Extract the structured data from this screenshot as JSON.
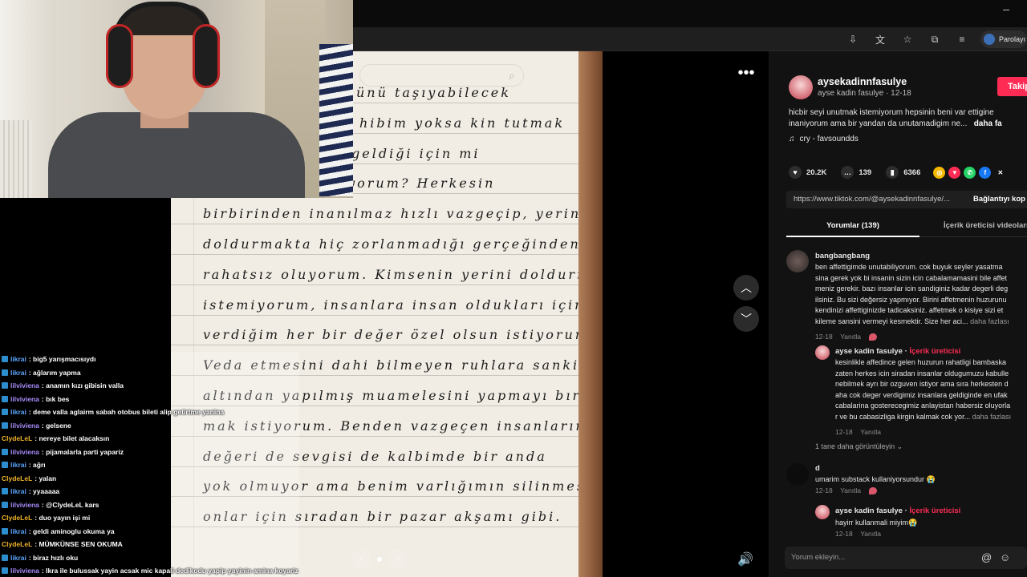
{
  "browser": {
    "password_button": "Parolayı"
  },
  "post": {
    "username": "aysekadinnfasulye",
    "subtitle": "ayse kadin fasulye · 12-18",
    "follow_label": "Takip",
    "description_line1": "hicbir seyi unutmak istemiyorum hepsinin beni var ettigine",
    "description_line2": "inaniyorum ama bir yandan da unutamadigim ne...",
    "description_more": "daha fa",
    "music": "cry - favsoundds",
    "likes": "20.2K",
    "comments_count": "139",
    "saves": "6366",
    "url": "https://www.tiktok.com/@aysekadinnfasulye/...",
    "copy_link": "Bağlantıyı kop",
    "tab_comments": "Yorumlar (139)",
    "tab_creator_videos": "İçerik üreticisi videoları",
    "comment_placeholder": "Yorum ekleyin..."
  },
  "comments": [
    {
      "name": "bangbangbang",
      "lines": [
        "ben affettigimde unutabiliyorum. cok buyuk seyler yasatma",
        "sina gerek yok bi insanin sizin icin cabalamamasini bile affet",
        "meniz gerekir. bazı insanlar icin sandiginiz kadar degerli deg",
        "ilsiniz. Bu sizi değersiz yapmıyor. Birini affetmenin huzurunu",
        "kendinizi affettiginizde tadicaksiniz. affetmek o kisiye sizi et",
        "kileme sansini vermeyi kesmektir. Size her aci..."
      ],
      "more": "daha fazlası",
      "date": "12-18",
      "reply": "Yanıtla"
    },
    {
      "name": "ayse kadin fasulye",
      "creator": "İçerik üreticisi",
      "lines": [
        "kesinlikle affedince gelen huzurun rahatligi bambaska",
        "zaten herkes icin siradan insanlar oldugumuzu kabulle",
        "nebilmek ayrı bir ozguven istiyor ama sıra herkesten d",
        "aha cok deger verdigimiz insanlara geldiginde en ufak",
        "cabalarina gosterecegimiz anlayistan habersiz oluyorla",
        "r ve bu cabasizliga kirgin kalmak cok yor..."
      ],
      "more": "daha fazlası",
      "date": "12-18",
      "reply": "Yanıtla"
    },
    {
      "name": "d",
      "lines": [
        "umarim substack kullaniyorsundur 😭"
      ],
      "date": "12-18",
      "reply": "Yanıtla"
    },
    {
      "name": "ayse kadin fasulye",
      "creator": "İçerik üreticisi",
      "lines": [
        "hayirr kullanmali miyim😭"
      ],
      "date": "12-18",
      "reply": "Yanıtla"
    }
  ],
  "view_more_replies": "1 tane daha görüntüleyin ⌄",
  "note": {
    "lines": [
      "ükünü taşıyabilecek",
      "hibim yoksa kin tutmak",
      "geldiği için mi",
      "çalışıyorum? Herkesin",
      "birbirinden inanılmaz hızlı vazgeçip, yerini",
      "doldurmakta hiç zorlanmadığı gerçeğinden",
      "rahatsız oluyorum. Kimsenin yerini doldurmak",
      "istemiyorum, insanlara insan oldukları için",
      "verdiğim her bir değer özel olsun istiyorum.",
      "Veda etmesini dahi bilmeyen ruhlara sanki",
      "altından yapılmış muamelesini yapmayı bırak-",
      "mak istiyorum. Benden vazgeçen insanların",
      "değeri de sevgisi de kalbimde bir anda",
      "yok olmuyor ama benim varlığımın silinmesi",
      "onlar için sıradan bir pazar akşamı gibi."
    ]
  },
  "chat": [
    {
      "user": "likrai",
      "text": ": big5 yarışmacısıydı",
      "color": "#5aa7ff"
    },
    {
      "user": "likrai",
      "text": ": ağlarım yapma",
      "color": "#5aa7ff"
    },
    {
      "user": "lilviviena",
      "text": ": anamın kızı gibisin valla",
      "color": "#a78bfa"
    },
    {
      "user": "lilviviena",
      "text": ": bık bes",
      "color": "#a78bfa"
    },
    {
      "user": "likrai",
      "text": ": deme valla aglairm sabah otobus bileti alip getirtme yanina",
      "color": "#5aa7ff"
    },
    {
      "user": "lilviviena",
      "text": ": gelsene",
      "color": "#a78bfa"
    },
    {
      "user": "ClydeLeL",
      "text": ": nereye bilet alacaksın",
      "color": "#f0b429"
    },
    {
      "user": "lilviviena",
      "text": ": pijamalarla parti yapariz",
      "color": "#a78bfa"
    },
    {
      "user": "likrai",
      "text": ": ağrı",
      "color": "#5aa7ff"
    },
    {
      "user": "ClydeLeL",
      "text": ": yalan",
      "color": "#f0b429"
    },
    {
      "user": "likrai",
      "text": ": yyaaaaa",
      "color": "#5aa7ff"
    },
    {
      "user": "lilviviena",
      "text": ": @ClydeLeL kars",
      "color": "#a78bfa"
    },
    {
      "user": "ClydeLeL",
      "text": ": duo yayın işi mi",
      "color": "#f0b429"
    },
    {
      "user": "likrai",
      "text": ": geldi aminoglu okuma ya",
      "color": "#5aa7ff"
    },
    {
      "user": "ClydeLeL",
      "text": ": MÜMKÜNSE SEN OKUMA",
      "color": "#f0b429"
    },
    {
      "user": "likrai",
      "text": ": biraz hızlı oku",
      "color": "#5aa7ff"
    },
    {
      "user": "lilviviena",
      "text": ": Ikra ile bulussak yayin acsak mic kapali dedikodu yapip yayinin amina koyariz",
      "color": "#a78bfa"
    }
  ]
}
